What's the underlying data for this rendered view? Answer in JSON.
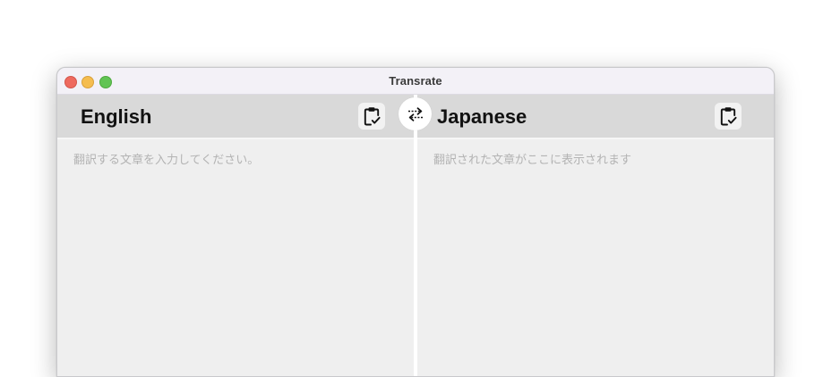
{
  "window": {
    "title": "Transrate"
  },
  "source": {
    "language": "English",
    "placeholder": "翻訳する文章を入力してください。"
  },
  "target": {
    "language": "Japanese",
    "placeholder": "翻訳された文章がここに表示されます"
  },
  "icons": {
    "paste": "clipboard-check-icon",
    "swap": "swap-arrows-icon"
  },
  "colors": {
    "close": "#ee6a5f",
    "minimize": "#f5bd4f",
    "maximize": "#61c454",
    "header": "#d9d9d9",
    "pane": "#efefef",
    "placeholder": "#b3b3b3"
  }
}
